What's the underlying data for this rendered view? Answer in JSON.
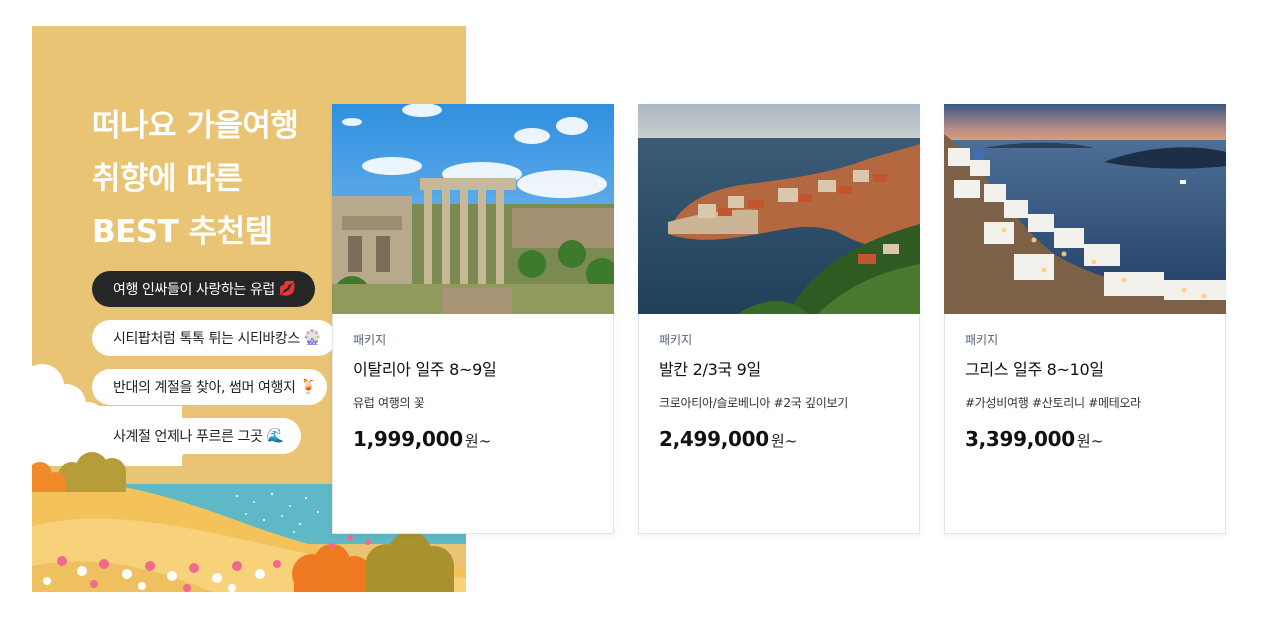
{
  "promo": {
    "title_lines": [
      "떠나요 가을여행",
      "취향에 따른",
      "BEST 추천템"
    ],
    "tags": [
      {
        "label": "여행 인싸들이 사랑하는 유럽",
        "emoji": "💋",
        "active": true
      },
      {
        "label": "시티팝처럼 톡톡 튀는 시티바캉스",
        "emoji": "🎡",
        "active": false
      },
      {
        "label": "반대의 계절을 찾아, 썸머 여행지",
        "emoji": "🍹",
        "active": false
      },
      {
        "label": "사계절 언제나 푸르른 그곳",
        "emoji": "🌊",
        "active": false
      }
    ],
    "background_color": "#e8c474"
  },
  "products": [
    {
      "type": "패키지",
      "name": "이탈리아 일주 8~9일",
      "desc": "유럽 여행의 꽃",
      "price": "1,999,000",
      "currency": "원~",
      "photo": "roman-forum-photo"
    },
    {
      "type": "패키지",
      "name": "발칸 2/3국 9일",
      "desc": "크로아티아/슬로베니아 #2국 깊이보기",
      "price": "2,499,000",
      "currency": "원~",
      "photo": "dubrovnik-photo"
    },
    {
      "type": "패키지",
      "name": "그리스 일주 8~10일",
      "desc": "#가성비여행 #산토리니 #메테오라",
      "price": "3,399,000",
      "currency": "원~",
      "photo": "santorini-photo"
    }
  ]
}
